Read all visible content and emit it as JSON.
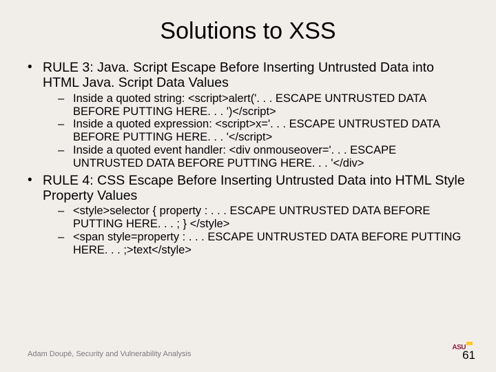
{
  "title": "Solutions to XSS",
  "bullets": [
    {
      "text": "RULE 3: Java. Script Escape Before Inserting Untrusted Data into HTML Java. Script Data Values",
      "sub": [
        "Inside a quoted string: <script>alert('. . . ESCAPE UNTRUSTED DATA BEFORE PUTTING HERE. . . ')</script>",
        "Inside a quoted expression: <script>x='. . . ESCAPE UNTRUSTED DATA BEFORE PUTTING HERE. . . '</script>",
        "Inside a quoted event handler: <div onmouseover='. . . ESCAPE UNTRUSTED DATA BEFORE PUTTING HERE. . . '</div>"
      ]
    },
    {
      "text": "RULE 4: CSS Escape Before Inserting Untrusted Data into HTML Style Property Values",
      "sub": [
        "<style>selector { property : . . . ESCAPE UNTRUSTED DATA BEFORE PUTTING HERE. . . ; } </style>",
        "<span style=property : . . . ESCAPE UNTRUSTED DATA BEFORE PUTTING HERE. . . ;>text</style>"
      ]
    }
  ],
  "footer": "Adam Doupé, Security and Vulnerability Analysis",
  "page_number": "61",
  "logo_text": "ASU"
}
